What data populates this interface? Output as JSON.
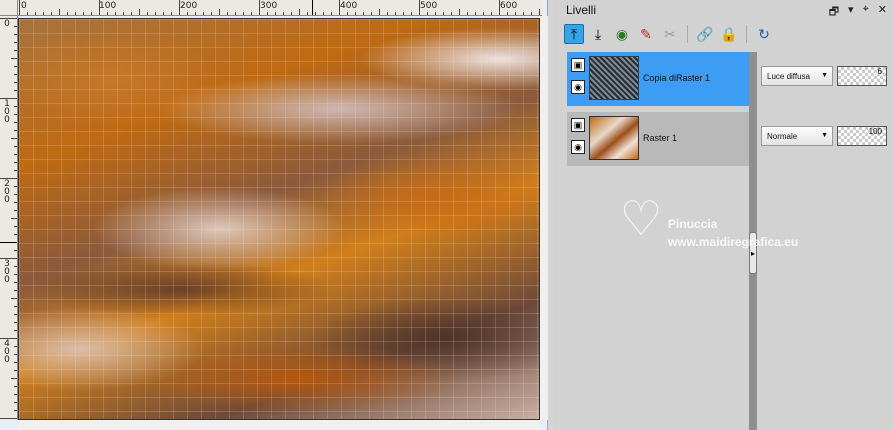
{
  "palette": {
    "title": "Livelli",
    "controls": [
      "restore-icon",
      "menu-arrow-icon",
      "pin-icon",
      "close-icon"
    ]
  },
  "toolbar": {
    "tools": [
      {
        "icon": "move-layer-up-icon",
        "state": "active"
      },
      {
        "icon": "move-layer-down-icon",
        "state": "normal"
      },
      {
        "icon": "visibility-toggle-icon",
        "state": "normal"
      },
      {
        "icon": "edit-layer-icon",
        "state": "normal"
      },
      {
        "icon": "delete-layer-icon",
        "state": "disabled"
      },
      {
        "icon": "link-icon",
        "state": "normal"
      },
      {
        "icon": "lock-icon",
        "state": "normal"
      },
      {
        "icon": "reset-icon",
        "state": "normal"
      }
    ]
  },
  "layers": [
    {
      "name": "Copia diRaster 1",
      "blend_mode": "Luce diffusa",
      "opacity": "6",
      "selected": true
    },
    {
      "name": "Raster 1",
      "blend_mode": "Normale",
      "opacity": "100",
      "selected": false
    }
  ],
  "rulers": {
    "horizontal": [
      "0",
      "100",
      "200",
      "300",
      "400",
      "500",
      "600"
    ],
    "vertical": [
      [
        "0"
      ],
      [
        "1",
        "0",
        "0"
      ],
      [
        "2",
        "0",
        "0"
      ],
      [
        "3",
        "0",
        "0"
      ],
      [
        "4",
        "0",
        "0"
      ]
    ]
  },
  "watermark": {
    "name": "Pinuccia",
    "url": "www.maidiregrafica.eu"
  },
  "colors": {
    "selection": "#3d9cf4",
    "palette_bg": "#d2d2d2"
  }
}
